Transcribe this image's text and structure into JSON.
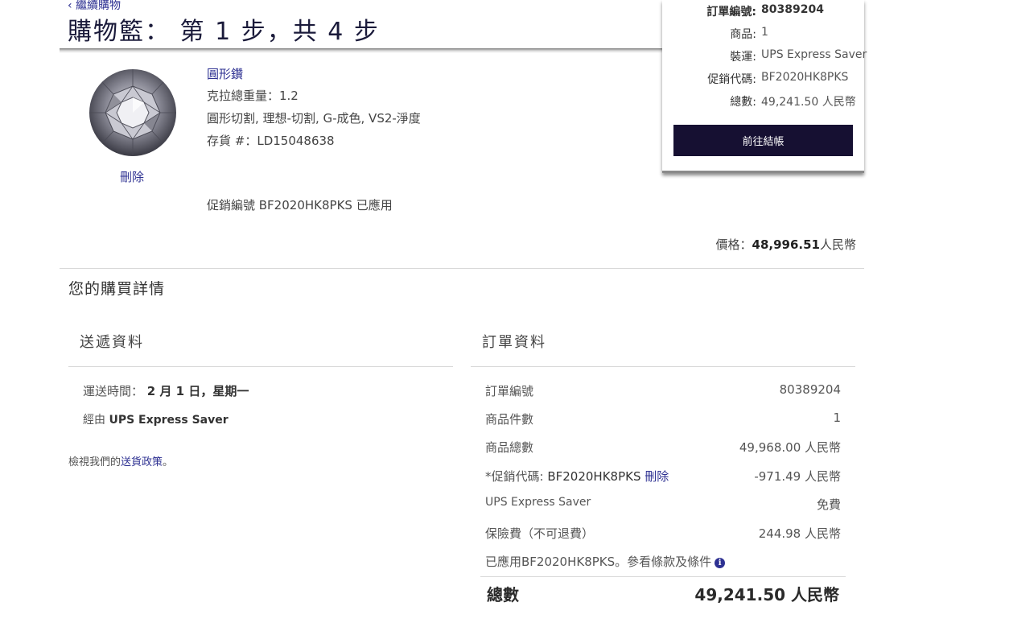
{
  "header": {
    "back_label": "繼續購物",
    "title": "購物籃： 第 1 步，共 4 步"
  },
  "summary": {
    "order_number_label": "訂單編號:",
    "order_number": "80389204",
    "items_label": "商品:",
    "items": "1",
    "shipping_label": "裝運:",
    "shipping": "UPS Express Saver",
    "promo_label": "促銷代碼:",
    "promo": "BF2020HK8PKS",
    "total_label": "總數:",
    "total": "49,241.50 人民幣",
    "checkout_label": "前往結帳"
  },
  "product": {
    "image_icon": "round-diamond-icon",
    "name": "圓形鑽",
    "carat": "克拉總重量：1.2",
    "details": "圓形切割, 理想-切割, G-成色, VS2-淨度",
    "stock": "存貨 #：LD15048638",
    "remove_label": "刪除",
    "promo_applied": "促銷編號 BF2020HK8PKS 已應用",
    "price_label": "價格：",
    "price_value": "48,996.51",
    "price_currency": "人民幣"
  },
  "details": {
    "title": "您的購買詳情",
    "shipping": {
      "title": "送遞資料",
      "delivery_label": "運送時間：",
      "delivery_value": "2 月 1 日，星期一",
      "via_label": "經由",
      "via_value": "UPS Express Saver",
      "policy_prefix": "檢視我們的",
      "policy_link": "送貨政策",
      "policy_suffix": "。"
    },
    "order": {
      "title": "訂單資料",
      "rows": [
        {
          "label": "訂單編號",
          "value": "80389204"
        },
        {
          "label": "商品件數",
          "value": "1"
        },
        {
          "label": "商品總數",
          "value": "49,968.00 人民幣"
        },
        {
          "label": "UPS Express Saver",
          "value": "免費"
        },
        {
          "label": "保險費（不可退費）",
          "value": "244.98 人民幣"
        }
      ],
      "promo_label": "*促銷代碼:",
      "promo_code": "BF2020HK8PKS",
      "promo_remove": "刪除",
      "promo_value": "-971.49 人民幣",
      "terms_text": "已應用BF2020HK8PKS。參看條款及條件",
      "total_label": "總數",
      "total_value": "49,241.50 人民幣"
    }
  },
  "colors": {
    "link": "#2e3192",
    "checkout_button": "#161032"
  }
}
